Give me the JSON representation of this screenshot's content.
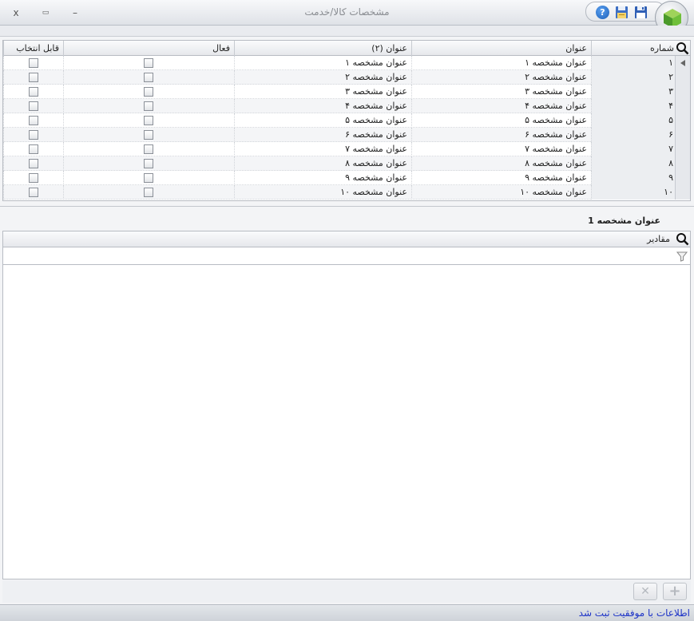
{
  "window": {
    "title": "مشخصات کالا/خدمت",
    "close_glyph": "x",
    "maximize_glyph": "▭",
    "minimize_glyph": "–",
    "help_glyph": "?"
  },
  "grid1": {
    "columns": {
      "number": "شماره",
      "title": "عنوان",
      "title2": "عنوان (۲)",
      "active": "فعال",
      "selectable": "قابل انتخاب"
    },
    "rows": [
      {
        "num": "۱",
        "title": "عنوان مشخصه ۱",
        "title2": "عنوان مشخصه ۱"
      },
      {
        "num": "۲",
        "title": "عنوان مشخصه ۲",
        "title2": "عنوان مشخصه ۲"
      },
      {
        "num": "۳",
        "title": "عنوان مشخصه ۳",
        "title2": "عنوان مشخصه ۳"
      },
      {
        "num": "۴",
        "title": "عنوان مشخصه ۴",
        "title2": "عنوان مشخصه ۴"
      },
      {
        "num": "۵",
        "title": "عنوان مشخصه ۵",
        "title2": "عنوان مشخصه ۵"
      },
      {
        "num": "۶",
        "title": "عنوان مشخصه ۶",
        "title2": "عنوان مشخصه ۶"
      },
      {
        "num": "۷",
        "title": "عنوان مشخصه ۷",
        "title2": "عنوان مشخصه ۷"
      },
      {
        "num": "۸",
        "title": "عنوان مشخصه ۸",
        "title2": "عنوان مشخصه ۸"
      },
      {
        "num": "۹",
        "title": "عنوان مشخصه ۹",
        "title2": "عنوان مشخصه ۹"
      },
      {
        "num": "۱۰",
        "title": "عنوان مشخصه ۱۰",
        "title2": "عنوان مشخصه ۱۰"
      }
    ]
  },
  "detail": {
    "section_title": "عنوان مشخصه 1",
    "values_header": "مقادیر"
  },
  "buttons": {
    "delete_glyph": "✕",
    "add_glyph": "+"
  },
  "status": {
    "message": "اطلاعات با موفقیت ثبت شد"
  }
}
